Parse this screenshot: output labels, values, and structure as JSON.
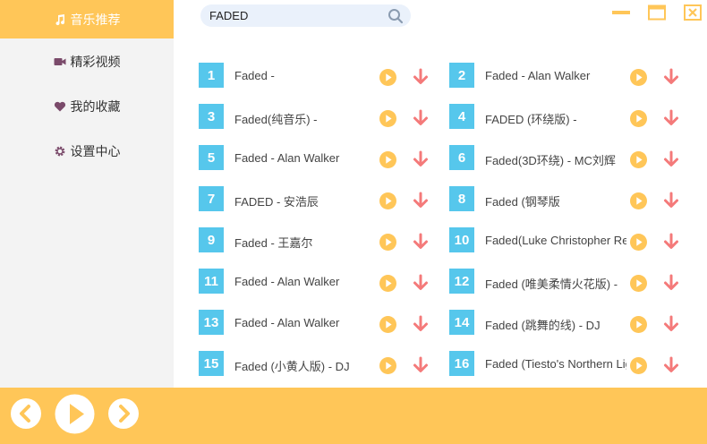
{
  "sidebar": {
    "items": [
      {
        "label": "音乐推荐",
        "icon": "music-note-icon",
        "active": true
      },
      {
        "label": "精彩视频",
        "icon": "video-camera-icon",
        "active": false
      },
      {
        "label": "我的收藏",
        "icon": "heart-icon",
        "active": false
      },
      {
        "label": "设置中心",
        "icon": "gear-icon",
        "active": false
      }
    ]
  },
  "search": {
    "value": "FADED",
    "icon": "search-icon"
  },
  "window_controls": [
    "minimize-icon",
    "maximize-icon",
    "close-icon"
  ],
  "songs": [
    {
      "num": "1",
      "title": "Faded - "
    },
    {
      "num": "2",
      "title": "Faded - Alan Walker"
    },
    {
      "num": "3",
      "title": "Faded(纯音乐) - "
    },
    {
      "num": "4",
      "title": "FADED (环绕版) - "
    },
    {
      "num": "5",
      "title": "Faded - Alan Walker"
    },
    {
      "num": "6",
      "title": "Faded(3D环绕) - MC刘辉"
    },
    {
      "num": "7",
      "title": "FADED - 安浩辰"
    },
    {
      "num": "8",
      "title": "Faded (钢琴版"
    },
    {
      "num": "9",
      "title": "Faded - 王嘉尔"
    },
    {
      "num": "10",
      "title": "Faded(Luke Christopher Remix)"
    },
    {
      "num": "11",
      "title": "Faded - Alan Walker"
    },
    {
      "num": "12",
      "title": "Faded (唯美柔情火花版) - "
    },
    {
      "num": "13",
      "title": "Faded - Alan Walker"
    },
    {
      "num": "14",
      "title": "Faded (跳舞的线) - DJ"
    },
    {
      "num": "15",
      "title": "Faded (小黄人版) - DJ"
    },
    {
      "num": "16",
      "title": "Faded (Tiesto's Northern Light Remix)"
    }
  ],
  "colors": {
    "accent": "#ffc658",
    "number_badge": "#56c7ec",
    "download": "#f47a7a",
    "play": "#ffc658"
  },
  "player": [
    "previous-icon",
    "play-icon",
    "next-icon"
  ]
}
